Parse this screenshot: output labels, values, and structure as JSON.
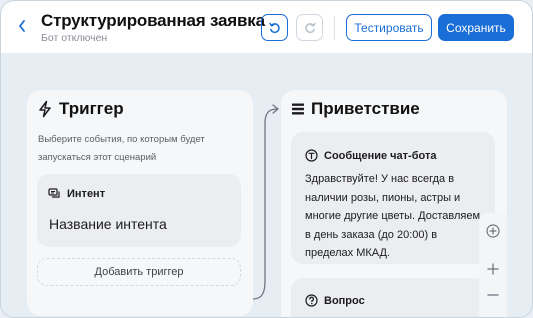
{
  "header": {
    "title": "Структурированная заявка",
    "subtitle": "Бот отключен",
    "test_label": "Тестировать",
    "save_label": "Сохранить"
  },
  "trigger_card": {
    "title": "Триггер",
    "description": "Выберите события, по которым будет запускаться этот сценарий",
    "intent_label": "Интент",
    "intent_name": "Название интента",
    "add_trigger_label": "Добавить триггер"
  },
  "greeting_card": {
    "title": "Приветствие",
    "message_label": "Сообщение чат-бота",
    "message_text": "Здравствуйте! У нас всегда в наличии розы, пионы, астры и многие другие цветы. Доставляем в день заказа (до 20:00) в пределах МКАД.",
    "question_label": "Вопрос"
  },
  "colors": {
    "accent": "#1a6ed8",
    "canvas_bg": "#e6eef4",
    "card_bg": "#f6f7f8"
  }
}
